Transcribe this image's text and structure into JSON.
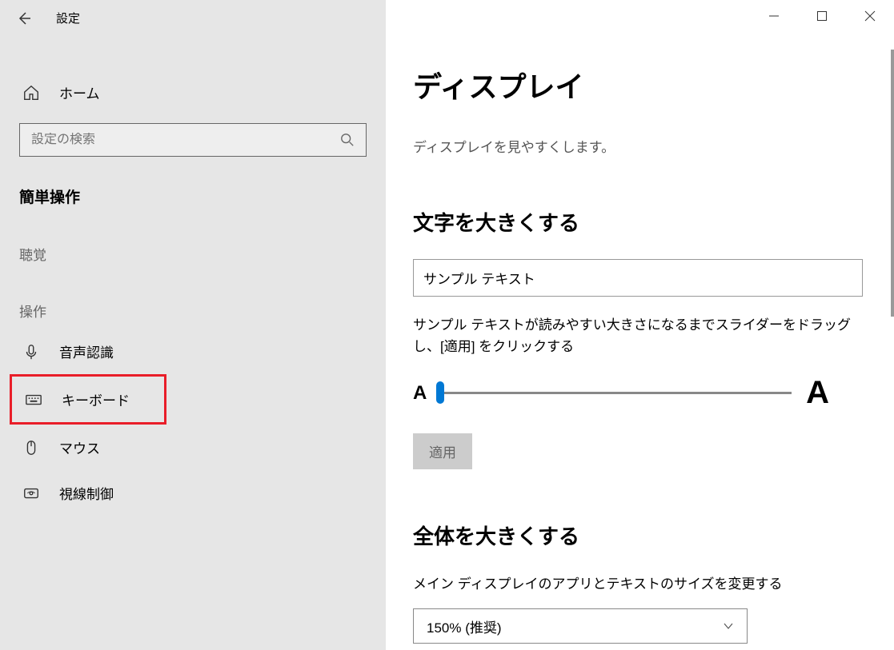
{
  "titlebar": {
    "title": "設定"
  },
  "sidebar": {
    "home": "ホーム",
    "search_placeholder": "設定の検索",
    "section": "簡単操作",
    "cat_hearing": "聴覚",
    "cat_interaction": "操作",
    "items": {
      "speech": "音声認識",
      "keyboard": "キーボード",
      "mouse": "マウス",
      "eye": "視線制御"
    }
  },
  "content": {
    "title": "ディスプレイ",
    "desc": "ディスプレイを見やすくします。",
    "text_size_heading": "文字を大きくする",
    "sample_text": "サンプル テキスト",
    "slider_desc": "サンプル テキストが読みやすい大きさになるまでスライダーをドラッグし、[適用] をクリックする",
    "apply": "適用",
    "scale_heading": "全体を大きくする",
    "scale_desc": "メイン ディスプレイのアプリとテキストのサイズを変更する",
    "scale_value": "150% (推奨)"
  }
}
